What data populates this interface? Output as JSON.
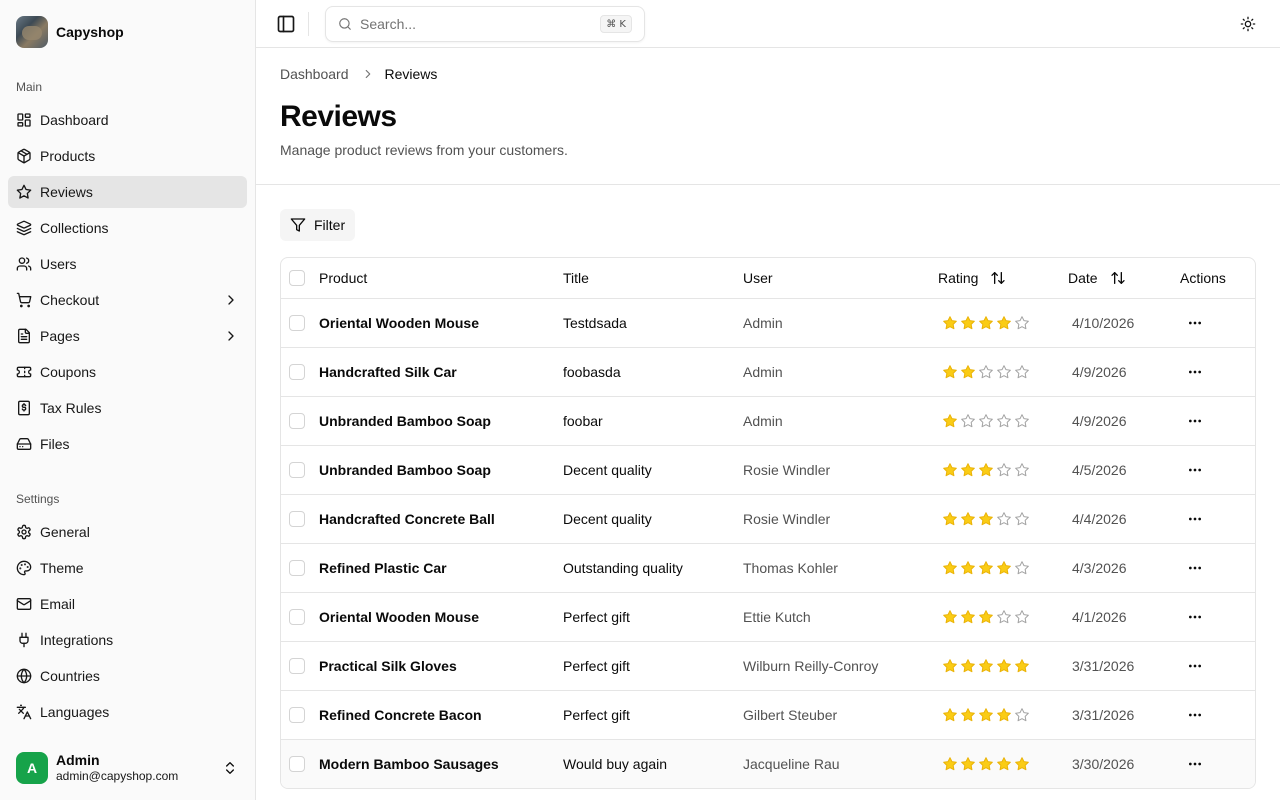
{
  "brand": {
    "name": "Capyshop"
  },
  "sidebar": {
    "main_label": "Main",
    "main_items": [
      {
        "label": "Dashboard",
        "icon": "dashboard-icon",
        "active": false,
        "chevron": false
      },
      {
        "label": "Products",
        "icon": "package-icon",
        "active": false,
        "chevron": false
      },
      {
        "label": "Reviews",
        "icon": "star-icon",
        "active": true,
        "chevron": false
      },
      {
        "label": "Collections",
        "icon": "layers-icon",
        "active": false,
        "chevron": false
      },
      {
        "label": "Users",
        "icon": "users-icon",
        "active": false,
        "chevron": false
      },
      {
        "label": "Checkout",
        "icon": "cart-icon",
        "active": false,
        "chevron": true
      },
      {
        "label": "Pages",
        "icon": "file-icon",
        "active": false,
        "chevron": true
      },
      {
        "label": "Coupons",
        "icon": "ticket-icon",
        "active": false,
        "chevron": false
      },
      {
        "label": "Tax Rules",
        "icon": "receipt-icon",
        "active": false,
        "chevron": false
      },
      {
        "label": "Files",
        "icon": "drive-icon",
        "active": false,
        "chevron": false
      }
    ],
    "settings_label": "Settings",
    "settings_items": [
      {
        "label": "General",
        "icon": "gear-icon"
      },
      {
        "label": "Theme",
        "icon": "palette-icon"
      },
      {
        "label": "Email",
        "icon": "mail-icon"
      },
      {
        "label": "Integrations",
        "icon": "plug-icon"
      },
      {
        "label": "Countries",
        "icon": "globe-icon"
      },
      {
        "label": "Languages",
        "icon": "translate-icon"
      }
    ],
    "user": {
      "initial": "A",
      "name": "Admin",
      "email": "admin@capyshop.com",
      "avatar_color": "#16a34a"
    }
  },
  "topbar": {
    "search_placeholder": "Search...",
    "search_shortcut": "⌘ K"
  },
  "breadcrumb": {
    "parent": "Dashboard",
    "current": "Reviews"
  },
  "page": {
    "title": "Reviews",
    "description": "Manage product reviews from your customers.",
    "filter_label": "Filter"
  },
  "table": {
    "columns": {
      "product": "Product",
      "title": "Title",
      "user": "User",
      "rating": "Rating",
      "date": "Date",
      "actions": "Actions"
    },
    "rows": [
      {
        "product": "Oriental Wooden Mouse",
        "title": "Testdsada",
        "user": "Admin",
        "rating": 4,
        "date": "4/10/2026"
      },
      {
        "product": "Handcrafted Silk Car",
        "title": "foobasda",
        "user": "Admin",
        "rating": 2,
        "date": "4/9/2026"
      },
      {
        "product": "Unbranded Bamboo Soap",
        "title": "foobar",
        "user": "Admin",
        "rating": 1,
        "date": "4/9/2026"
      },
      {
        "product": "Unbranded Bamboo Soap",
        "title": "Decent quality",
        "user": "Rosie Windler",
        "rating": 3,
        "date": "4/5/2026"
      },
      {
        "product": "Handcrafted Concrete Ball",
        "title": "Decent quality",
        "user": "Rosie Windler",
        "rating": 3,
        "date": "4/4/2026"
      },
      {
        "product": "Refined Plastic Car",
        "title": "Outstanding quality",
        "user": "Thomas Kohler",
        "rating": 4,
        "date": "4/3/2026"
      },
      {
        "product": "Oriental Wooden Mouse",
        "title": "Perfect gift",
        "user": "Ettie Kutch",
        "rating": 3,
        "date": "4/1/2026"
      },
      {
        "product": "Practical Silk Gloves",
        "title": "Perfect gift",
        "user": "Wilburn Reilly-Conroy",
        "rating": 5,
        "date": "3/31/2026"
      },
      {
        "product": "Refined Concrete Bacon",
        "title": "Perfect gift",
        "user": "Gilbert Steuber",
        "rating": 4,
        "date": "3/31/2026"
      },
      {
        "product": "Modern Bamboo Sausages",
        "title": "Would buy again",
        "user": "Jacqueline Rau",
        "rating": 5,
        "date": "3/30/2026"
      }
    ],
    "max_rating": 5
  },
  "colors": {
    "star_filled": "#facc15",
    "star_empty": "#a3a3a3",
    "active_nav_bg": "#e5e5e5"
  }
}
